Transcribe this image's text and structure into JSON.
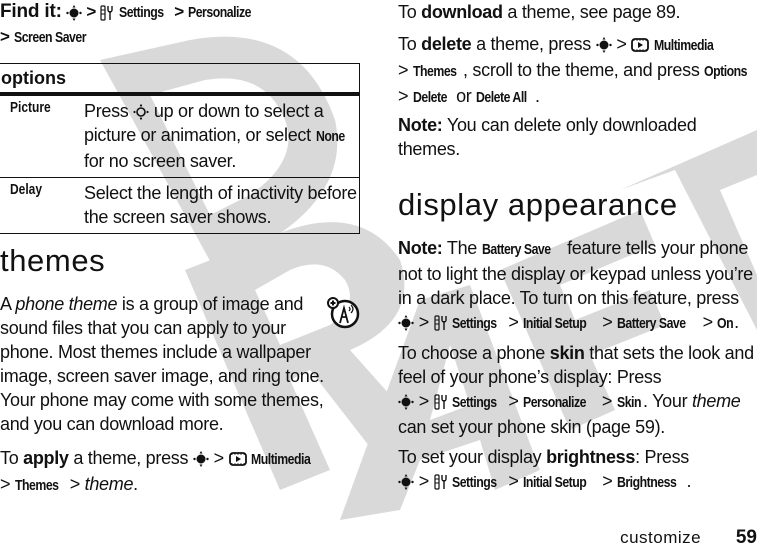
{
  "watermark": {
    "text": "DRAFT",
    "color": "#d9d9d9"
  },
  "find_it": {
    "label": "Find it:",
    "path": [
      {
        "icon": "nav-key-icon"
      },
      {
        "sep": ">"
      },
      {
        "icon": "settings-icon",
        "text": "Settings"
      },
      {
        "sep": ">"
      },
      {
        "text": "Personalize"
      },
      {
        "sep": ">"
      },
      {
        "text": "Screen Saver"
      }
    ],
    "settings": "Settings",
    "personalize": "Personalize",
    "screen_saver": "Screen Saver",
    "sep": ">"
  },
  "options_table": {
    "header": "options",
    "rows": [
      {
        "name": "Picture",
        "desc_a": "Press",
        "desc_b": "up or down to select a picture or animation, or select",
        "desc_key": "None",
        "desc_c": "for no screen saver."
      },
      {
        "name": "Delay",
        "desc": "Select the length of inactivity before the screen saver shows."
      }
    ]
  },
  "themes": {
    "heading": "themes",
    "intro_a": "A",
    "intro_em": "phone theme",
    "intro_b": "is a group of image and sound files that you can apply to your phone. Most themes include a wallpaper image, screen saver image, and ring tone. Your phone may come with some themes, and you can download more.",
    "apply_a": "To",
    "apply_b": "apply",
    "apply_c": "a theme, press",
    "multimedia": "Multimedia",
    "themes_menu": "Themes",
    "theme_em": "theme",
    "download_a": "To",
    "download_b": "download",
    "download_c": "a theme, see page 89.",
    "delete_a": "To",
    "delete_b": "delete",
    "delete_c": "a theme, press",
    "delete_d": ", scroll to the theme, and press",
    "options_key": "Options",
    "delete_key": "Delete",
    "or": "or",
    "delete_all_key": "Delete All",
    "note_label": "Note:",
    "note_text": "You can delete only downloaded themes."
  },
  "display": {
    "heading": "display appearance",
    "note_label": "Note:",
    "note_a": "The",
    "battery_save": "Battery Save",
    "note_b": "feature tells your phone not to light the display or keypad unless you’re in a dark place. To turn on this feature, press",
    "settings": "Settings",
    "initial_setup": "Initial Setup",
    "on": "On",
    "skin_a": "To choose a phone",
    "skin_b": "skin",
    "skin_c": "that sets the look and feel of your phone’s display: Press",
    "personalize": "Personalize",
    "skin_key": "Skin",
    "skin_d": ". Your",
    "skin_em": "theme",
    "skin_e": "can set your phone skin (page 59).",
    "bright_a": "To set your display",
    "bright_b": "brightness",
    "bright_c": ": Press",
    "brightness_key": "Brightness"
  },
  "footer": {
    "section": "customize",
    "page_number": "59"
  },
  "sep": ">",
  "period": "."
}
